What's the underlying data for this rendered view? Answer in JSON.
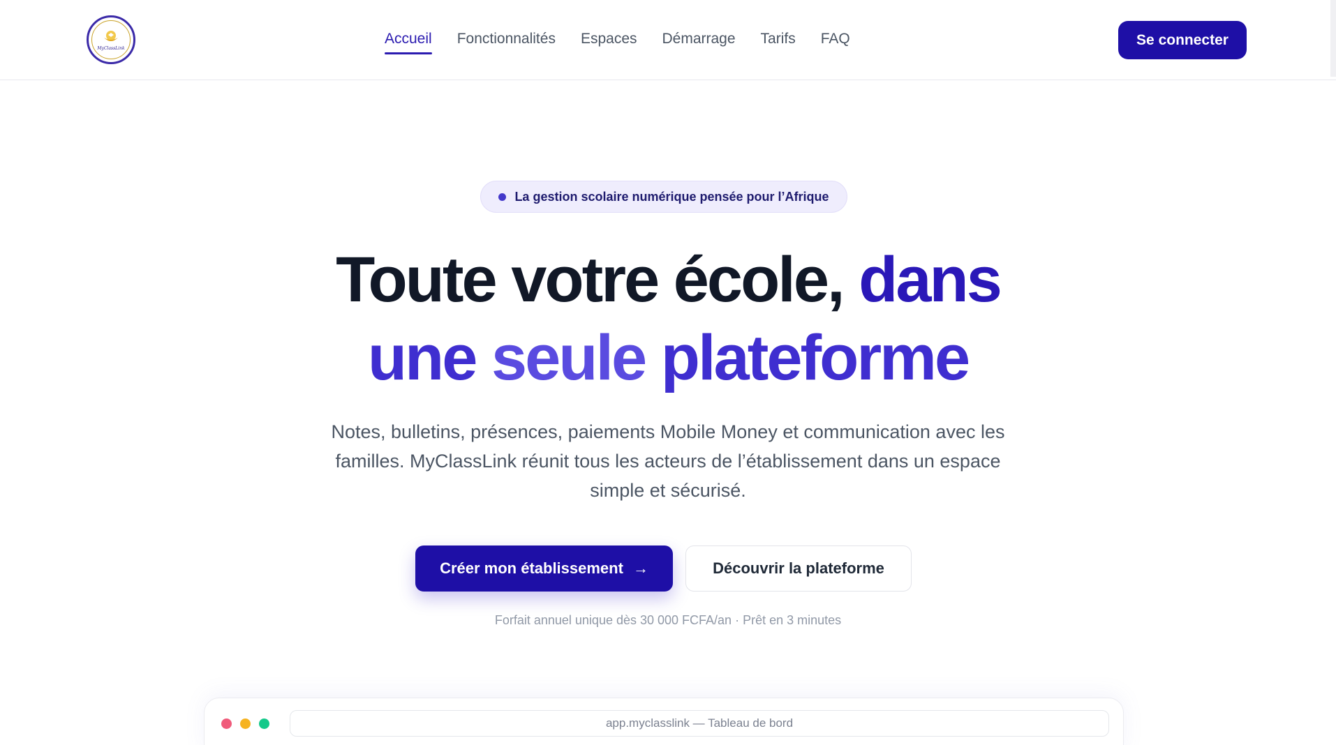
{
  "header": {
    "logo": {
      "text": "MyClassLink",
      "icon": "school-emblem-icon"
    },
    "nav": [
      {
        "label": "Accueil",
        "active": true
      },
      {
        "label": "Fonctionnalités",
        "active": false
      },
      {
        "label": "Espaces",
        "active": false
      },
      {
        "label": "Démarrage",
        "active": false
      },
      {
        "label": "Tarifs",
        "active": false
      },
      {
        "label": "FAQ",
        "active": false
      }
    ],
    "login_label": "Se connecter"
  },
  "hero": {
    "badge": "La gestion scolaire numérique pensée pour l’Afrique",
    "headline": {
      "part1": "Toute votre école, ",
      "part2": "dans",
      "part3": "une ",
      "part4": "seule",
      "part5": " plateforme"
    },
    "subtitle": "Notes, bulletins, présences, paiements Mobile Money et communication avec les familles. MyClassLink réunit tous les acteurs de l’établissement dans un espace simple et sécurisé.",
    "cta_primary": "Créer mon établissement",
    "cta_primary_arrow": "→",
    "cta_secondary": "Découvrir la plateforme",
    "note": "Forfait annuel unique dès 30 000 FCFA/an · Prêt en 3 minutes"
  },
  "preview": {
    "url": "app.myclasslink — Tableau de bord"
  },
  "colors": {
    "brand": "#1e0fa6",
    "accent": "#5a4be0",
    "dot_red": "#f05a7a",
    "dot_yellow": "#f6b321",
    "dot_green": "#14c98a"
  }
}
